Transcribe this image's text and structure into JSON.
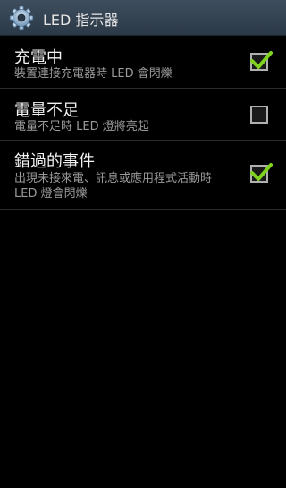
{
  "header": {
    "title": "LED 指示器",
    "icon": "gear-icon"
  },
  "settings": [
    {
      "title": "充電中",
      "summary": "裝置連接充電器時 LED 會閃爍",
      "checked": true
    },
    {
      "title": "電量不足",
      "summary": "電量不足時 LED 燈將亮起",
      "checked": false
    },
    {
      "title": "錯過的事件",
      "summary": "出現未接來電、訊息或應用程式活動時 LED 燈會閃爍",
      "checked": true
    }
  ],
  "colors": {
    "header_bg": "#354554",
    "check_color": "#7fd21f",
    "divider": "#2c2c2c"
  }
}
